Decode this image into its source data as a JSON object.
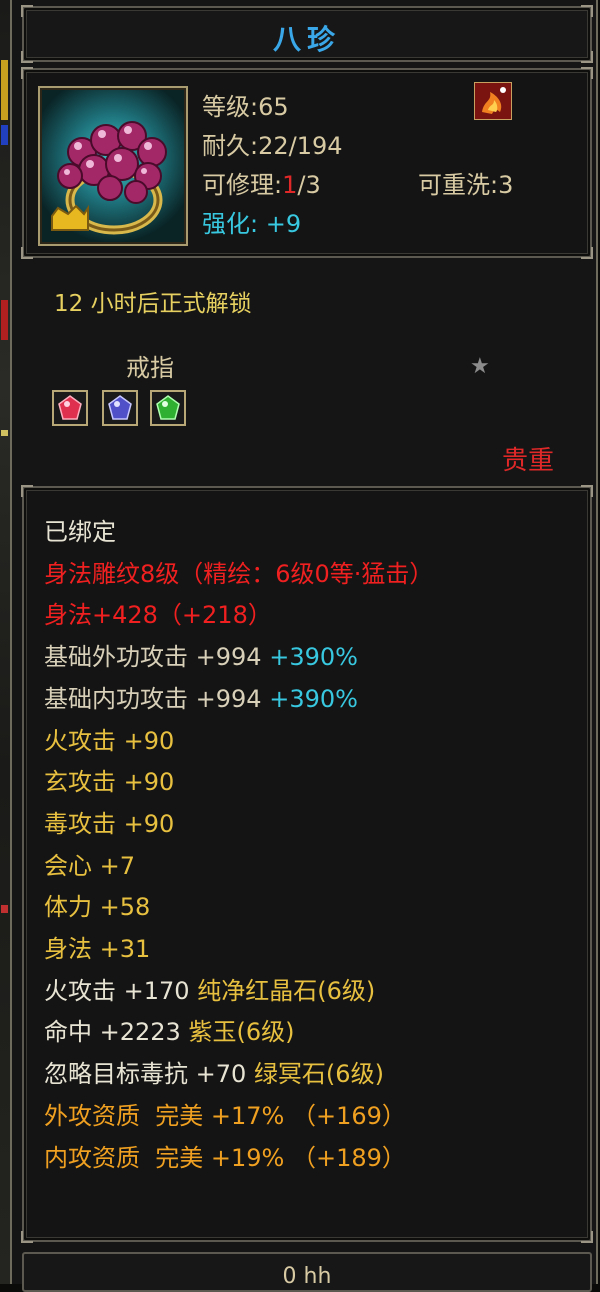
{
  "item": {
    "name": "八珍",
    "stats": {
      "level_label": "等级",
      "level": "65",
      "durability_label": "耐久",
      "durability": "22/194",
      "repair_label": "可修理",
      "repair_current": "1",
      "repair_max": "/3",
      "rewash_label": "可重洗",
      "rewash": "3",
      "enhance_label": "强化",
      "enhance": "+9"
    },
    "unlock_text": "12 小时后正式解锁",
    "type_label": "戒指",
    "precious_label": "贵重",
    "icons": {
      "item": "ring-icon",
      "badge": "flame-emblem-icon",
      "star": "star-icon",
      "gems": [
        "red-gem-icon",
        "purple-gem-icon",
        "green-gem-icon"
      ]
    }
  },
  "attributes": {
    "bound": "已绑定",
    "engrave": "身法雕纹8级（精绘：6级0等·猛击）",
    "agility_main": "身法+428（+218）",
    "lines": [
      {
        "label": "基础外功攻击",
        "value": "+994",
        "extra": "+390%"
      },
      {
        "label": "基础内功攻击",
        "value": "+994",
        "extra": "+390%"
      }
    ],
    "bonus_lines": [
      {
        "label": "火攻击",
        "value": "+90"
      },
      {
        "label": "玄攻击",
        "value": "+90"
      },
      {
        "label": "毒攻击",
        "value": "+90"
      },
      {
        "label": "会心",
        "value": "+7"
      },
      {
        "label": "体力",
        "value": "+58"
      },
      {
        "label": "身法",
        "value": "+31"
      }
    ],
    "gem_lines": [
      {
        "label": "火攻击",
        "value": "+170",
        "gem": "纯净红晶石(6级)"
      },
      {
        "label": "命中",
        "value": "+2223",
        "gem": "紫玉(6级)"
      },
      {
        "label": "忽略目标毒抗",
        "value": "+70",
        "gem": "绿冥石(6级)"
      }
    ],
    "quality_lines": [
      {
        "label": "外攻资质",
        "grade": "完美",
        "value": "+17%",
        "extra": "（+169）"
      },
      {
        "label": "内攻资质",
        "grade": "完美",
        "value": "+19%",
        "extra": "（+189）"
      }
    ]
  },
  "footer": {
    "text": "0 hh"
  }
}
